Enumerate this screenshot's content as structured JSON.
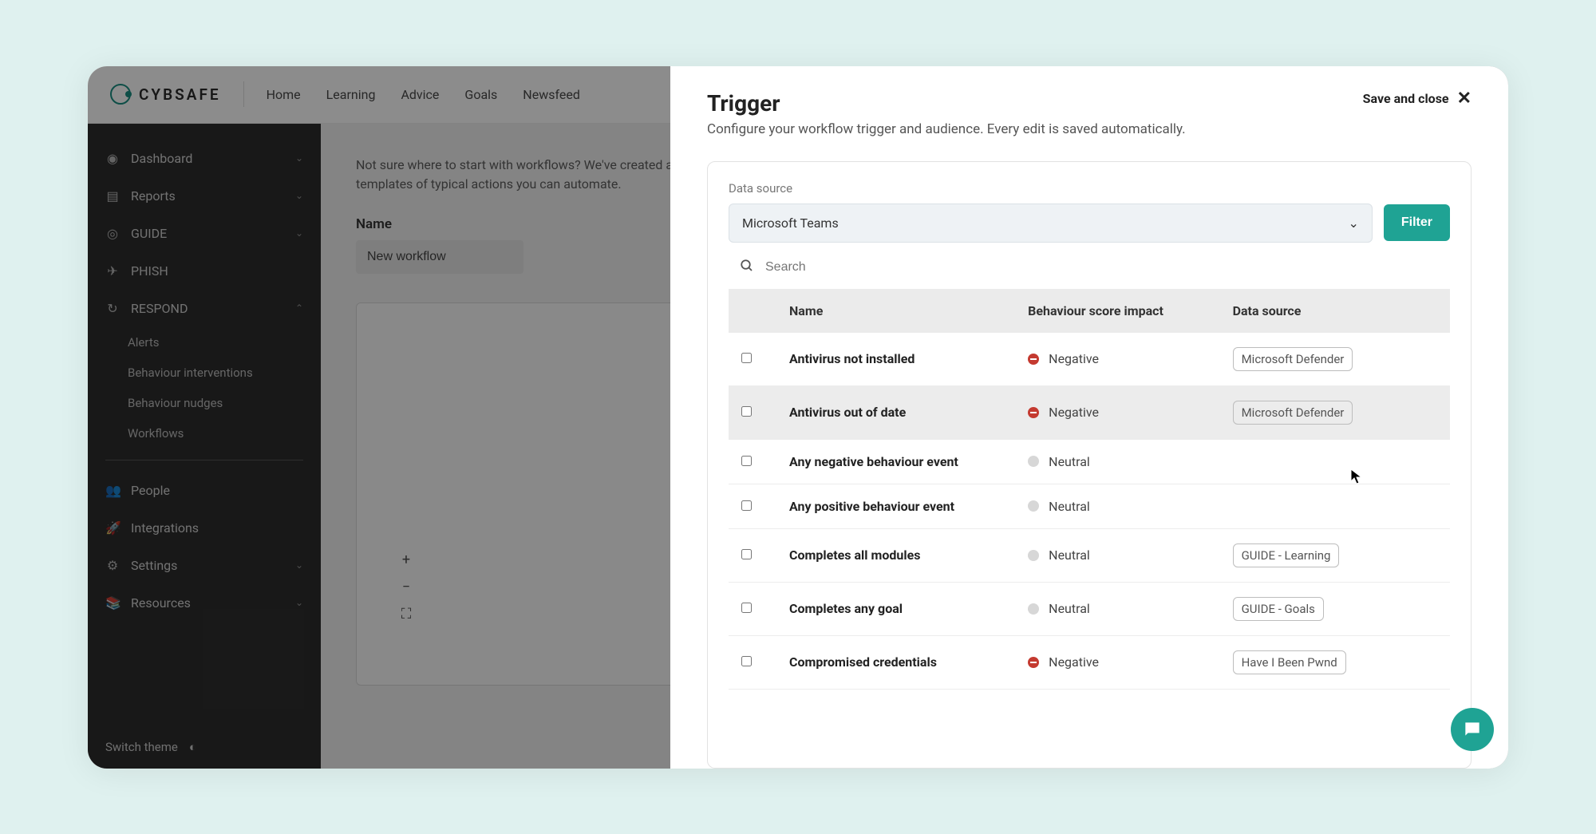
{
  "brand": {
    "name": "CYBSAFE"
  },
  "topnav": [
    "Home",
    "Learning",
    "Advice",
    "Goals",
    "Newsfeed"
  ],
  "sidebar": {
    "items": [
      {
        "label": "Dashboard",
        "icon": "◉",
        "expandable": true
      },
      {
        "label": "Reports",
        "icon": "▤",
        "expandable": true
      },
      {
        "label": "GUIDE",
        "icon": "◎",
        "expandable": true
      },
      {
        "label": "PHISH",
        "icon": "✈"
      },
      {
        "label": "RESPOND",
        "icon": "↻",
        "expandable": true,
        "expanded": true,
        "children": [
          "Alerts",
          "Behaviour interventions",
          "Behaviour nudges",
          "Workflows"
        ]
      }
    ],
    "footer_items": [
      {
        "label": "People",
        "icon": "👥"
      },
      {
        "label": "Integrations",
        "icon": "🚀"
      },
      {
        "label": "Settings",
        "icon": "⚙",
        "expandable": true
      },
      {
        "label": "Resources",
        "icon": "📚",
        "expandable": true
      }
    ],
    "theme_switch": "Switch theme"
  },
  "content": {
    "helper": "Not sure where to start with workflows? We've created a number of templates of typical actions you can automate.",
    "name_label": "Name",
    "name_value": "New workflow"
  },
  "modal": {
    "title": "Trigger",
    "subtitle": "Configure your workflow trigger and audience. Every edit is saved automatically.",
    "save_close": "Save and close",
    "data_source_label": "Data source",
    "data_source_value": "Microsoft Teams",
    "filter_label": "Filter",
    "search_placeholder": "Search",
    "columns": {
      "name": "Name",
      "impact": "Behaviour score impact",
      "source": "Data source"
    },
    "rows": [
      {
        "name": "Antivirus not installed",
        "impact": "Negative",
        "dot": "neg",
        "source": "Microsoft Defender"
      },
      {
        "name": "Antivirus out of date",
        "impact": "Negative",
        "dot": "neg",
        "source": "Microsoft Defender",
        "highlight": true
      },
      {
        "name": "Any negative behaviour event",
        "impact": "Neutral",
        "dot": "neu",
        "source": ""
      },
      {
        "name": "Any positive behaviour event",
        "impact": "Neutral",
        "dot": "neu",
        "source": ""
      },
      {
        "name": "Completes all modules",
        "impact": "Neutral",
        "dot": "neu",
        "source": "GUIDE - Learning"
      },
      {
        "name": "Completes any goal",
        "impact": "Neutral",
        "dot": "neu",
        "source": "GUIDE - Goals"
      },
      {
        "name": "Compromised credentials",
        "impact": "Negative",
        "dot": "neg",
        "source": "Have I Been Pwnd"
      }
    ]
  }
}
